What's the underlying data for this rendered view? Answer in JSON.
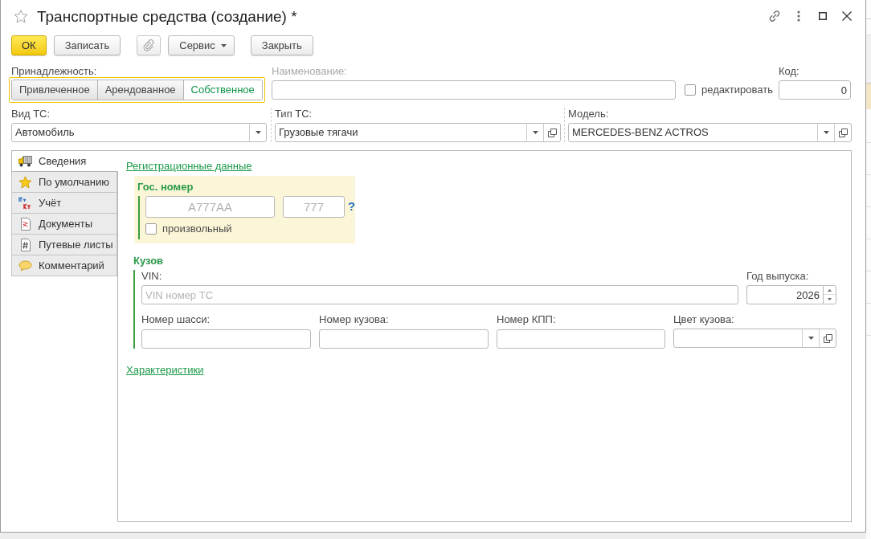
{
  "window": {
    "title": "Транспортные средства (создание) *",
    "favorite": false
  },
  "toolbar": {
    "groups": [
      [
        {
          "kind": "default",
          "label": "ОК"
        },
        {
          "kind": "normal",
          "label": "Записать"
        }
      ],
      [
        {
          "kind": "attach"
        },
        {
          "kind": "menu",
          "label": "Сервис"
        }
      ],
      [
        {
          "kind": "normal",
          "label": "Закрыть"
        }
      ]
    ]
  },
  "ownership": {
    "label": "Принадлежность:",
    "options": [
      {
        "label": "Привлеченное",
        "selected": false
      },
      {
        "label": "Арендованное",
        "selected": false
      },
      {
        "label": "Собственное",
        "selected": true
      }
    ]
  },
  "name_field": {
    "label": "Наименование:",
    "disabled": true
  },
  "edit_checkbox": {
    "label": "редактировать",
    "checked": false
  },
  "code_field": {
    "label": "Код:",
    "value": "0"
  },
  "selectors": [
    {
      "label": "Вид ТС:",
      "value": "Автомобиль",
      "openable": false
    },
    {
      "label": "Тип ТС:",
      "value": "Грузовые тягачи",
      "openable": true
    },
    {
      "label": "Модель:",
      "value": "MERCEDES-BENZ ACTROS",
      "openable": true
    }
  ],
  "side_tabs": [
    {
      "label": "Сведения",
      "kind": "truck",
      "selected": true
    },
    {
      "label": "По умолчанию",
      "kind": "star",
      "selected": false
    },
    {
      "label": "Учёт",
      "kind": "ledger",
      "selected": false
    },
    {
      "label": "Документы",
      "kind": "document",
      "selected": false
    },
    {
      "label": "Путевые листы",
      "kind": "sheet",
      "selected": false
    },
    {
      "label": "Комментарий",
      "kind": "comment",
      "selected": false
    }
  ],
  "registration": {
    "link": "Регистрационные данные",
    "plate": {
      "title": "Гос. номер",
      "number": {
        "placeholder": "А777АА"
      },
      "region": {
        "placeholder": "777"
      },
      "help": "?",
      "arbitrary": {
        "label": "произвольный",
        "checked": false
      }
    }
  },
  "body": {
    "title": "Кузов",
    "vin": {
      "label": "VIN:",
      "placeholder": "VIN номер ТС"
    },
    "year": {
      "label": "Год выпуска:",
      "value": "2026"
    },
    "fields": [
      {
        "label": "Номер шасси:",
        "kind": "text"
      },
      {
        "label": "Номер кузова:",
        "kind": "text"
      },
      {
        "label": "Номер КПП:",
        "kind": "text"
      },
      {
        "label": "Цвет кузова:",
        "kind": "select",
        "openable": true
      }
    ]
  },
  "characteristics_link": "Характеристики"
}
